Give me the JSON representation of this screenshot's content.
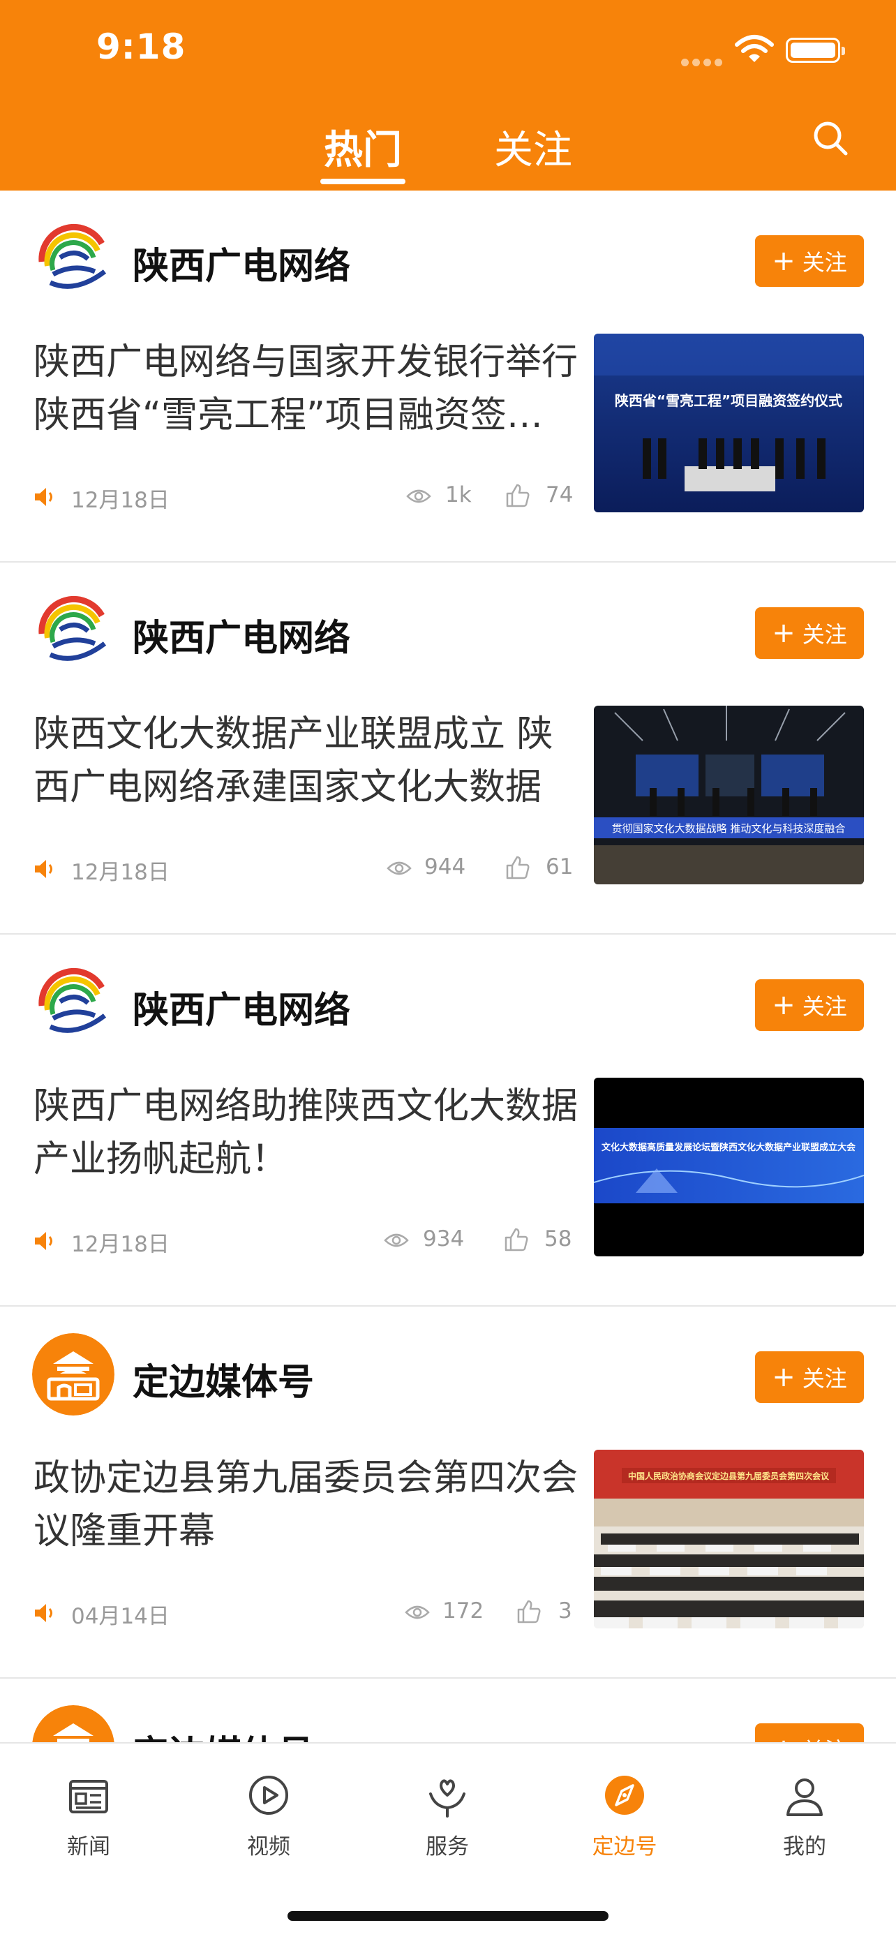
{
  "status_bar": {
    "time": "9:18"
  },
  "header": {
    "tabs": [
      {
        "label": "热门",
        "active": true
      },
      {
        "label": "关注",
        "active": false
      }
    ],
    "search_icon": "search-icon",
    "accent_color": "#F7830A"
  },
  "feed": [
    {
      "source": "陕西广电网络",
      "follow_label": "关注",
      "title": "陕西广电网络与国家开发银行举行陕西省“雪亮工程”项目融资签约仪式",
      "date": "12月18日",
      "views": "1k",
      "likes": "74",
      "thumb_caption": "陕西省“雪亮工程”项目融资签约仪式"
    },
    {
      "source": "陕西广电网络",
      "follow_label": "关注",
      "title": "陕西文化大数据产业联盟成立 陕西广电网络承建国家文化大数据",
      "date": "12月18日",
      "views": "944",
      "likes": "61",
      "thumb_caption": "贯彻国家文化大数据战略 推动文化与科技深度融合"
    },
    {
      "source": "陕西广电网络",
      "follow_label": "关注",
      "title": "陕西广电网络助推陕西文化大数据产业扬帆起航！",
      "date": "12月18日",
      "views": "934",
      "likes": "58",
      "thumb_caption": "文化大数据高质量发展论坛暨陕西文化大数据产业联盟成立大会"
    },
    {
      "source": "定边媒体号",
      "follow_label": "关注",
      "title": "政协定边县第九届委员会第四次会议隆重开幕",
      "date": "04月14日",
      "views": "172",
      "likes": "3",
      "thumb_caption": "中国人民政治协商会议定边县第九届委员会第四次会议"
    }
  ],
  "partial_card": {
    "source": "定边媒体号",
    "follow_label": "关注"
  },
  "tabbar": [
    {
      "label": "新闻",
      "icon": "news-icon",
      "active": false
    },
    {
      "label": "视频",
      "icon": "video-icon",
      "active": false
    },
    {
      "label": "服务",
      "icon": "service-icon",
      "active": false
    },
    {
      "label": "定边号",
      "icon": "compass-icon",
      "active": true
    },
    {
      "label": "我的",
      "icon": "user-icon",
      "active": false
    }
  ]
}
